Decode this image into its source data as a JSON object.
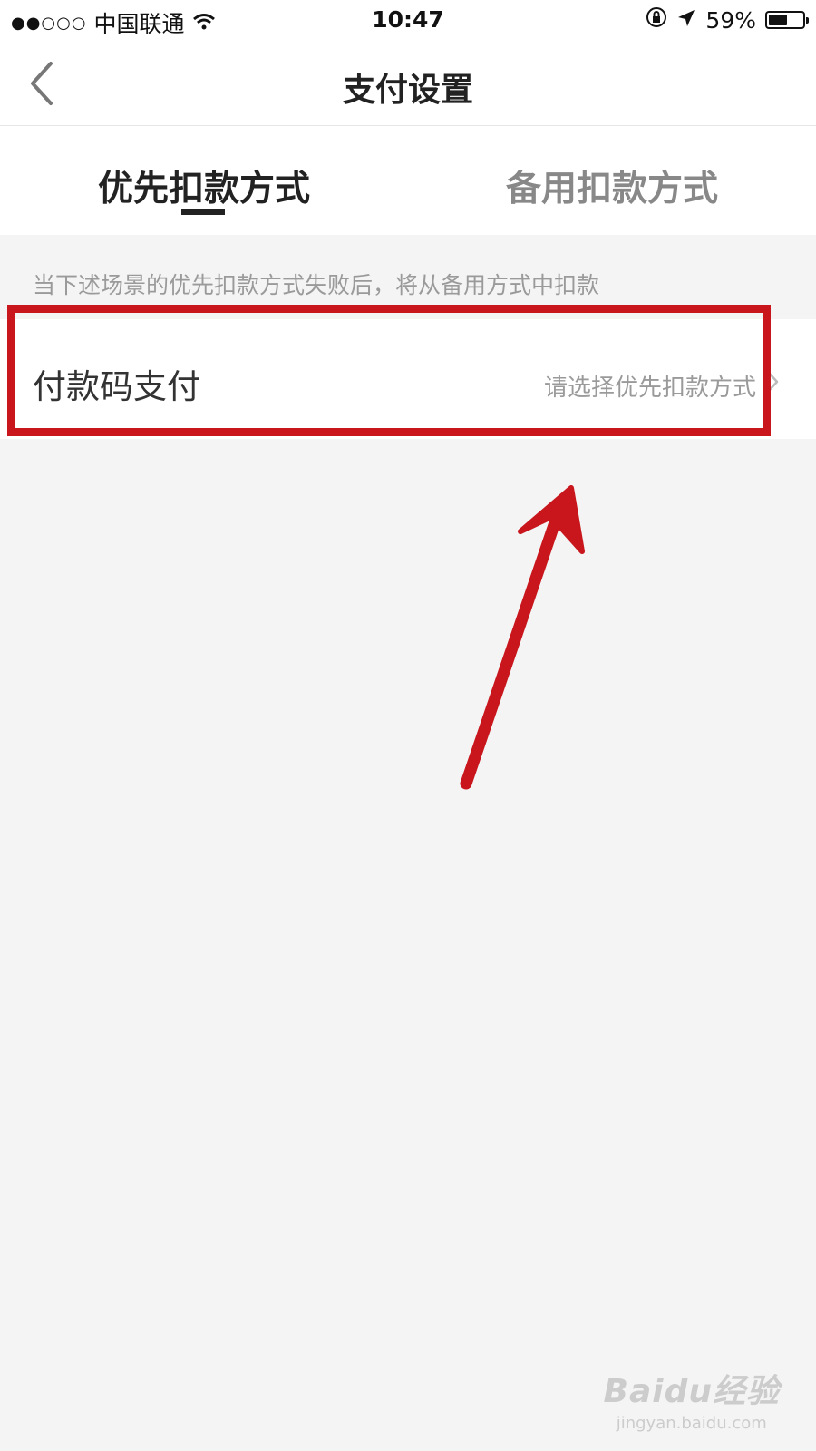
{
  "status_bar": {
    "signal_dots": "●●○○○",
    "carrier": "中国联通",
    "time": "10:47",
    "battery": "59%",
    "battery_level": 0.59
  },
  "navbar": {
    "title": "支付设置"
  },
  "tabs": [
    {
      "label": "优先扣款方式",
      "active": true
    },
    {
      "label": "备用扣款方式",
      "active": false
    }
  ],
  "hint": "当下述场景的优先扣款方式失败后，将从备用方式中扣款",
  "setting_row": {
    "label": "付款码支付",
    "value": "请选择优先扣款方式"
  },
  "annotation_color": "#c8161c",
  "watermark": {
    "brand": "Baidu经验",
    "url": "jingyan.baidu.com"
  }
}
